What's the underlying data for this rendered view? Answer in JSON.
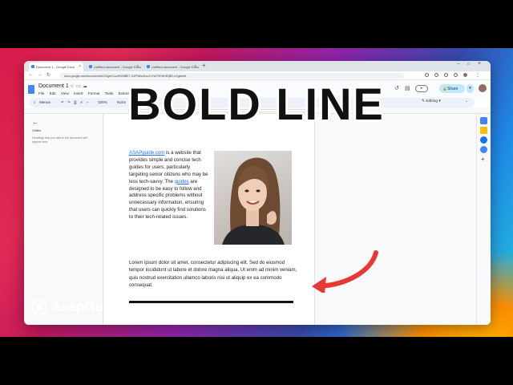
{
  "browser": {
    "tabs": [
      {
        "label": "Document 1 - Google Docs",
        "color": "#4285f4"
      },
      {
        "label": "Untitled document - Google Docs",
        "color": "#4285f4"
      },
      {
        "label": "Untitled document - Google Docs",
        "color": "#4285f4"
      }
    ],
    "new_tab": "+",
    "url": "docs.google.com/document/d/1X3gmCuu/WW8BE7-GZPWbo2mu7o7vKF8Y6Hfl7j8D-eYgk/edit"
  },
  "docs": {
    "title": "Document 1",
    "menu": [
      "File",
      "Edit",
      "View",
      "Insert",
      "Format",
      "Tools",
      "Extensions"
    ],
    "share_label": "Share",
    "toolbar": {
      "search": "Menus",
      "zoom": "100%",
      "style": "Norm"
    },
    "mode_label": "Editing",
    "outline": {
      "title": "Outline",
      "hint": "Headings that you add to the document will appear here."
    },
    "body": {
      "link1": "ASAPguide.com",
      "p1a": " is a website that provides simple and concise tech guides for users, particularly targeting senior citizens who may be less tech-savvy. The ",
      "link2": "guides",
      "p1b": " are designed to  be easy to follow and address specific problems without  unnecessary information, ensuring that users can quickly find solutions to their tech-related issues.",
      "p2": "Lorem ipsum dolor sit amet, consectetur adipiscing elit. Sed do eiusmod tempor incididunt ut labore et dolore magna aliqua. Ut enim ad minim veniam, quis nostrud exercitation ullamco laboris nisi ut aliquip ex ea commodo consequat."
    }
  },
  "overlay": {
    "headline": "BOLD LINE",
    "brand": "AsapGuide",
    "arrow_color": "#e53935"
  }
}
